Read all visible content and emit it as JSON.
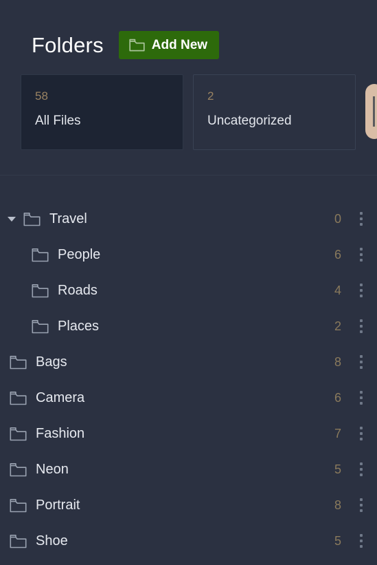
{
  "header": {
    "title": "Folders",
    "add_button": {
      "label": "Add New",
      "icon": "folder-icon",
      "color": "#2d6a0b"
    }
  },
  "stats": {
    "cards": [
      {
        "count": "58",
        "label": "All Files",
        "selected": true
      },
      {
        "count": "2",
        "label": "Uncategorized",
        "selected": false
      }
    ],
    "peek_card": {
      "color": "#d9bda6"
    }
  },
  "colors": {
    "background": "#2b3141",
    "card_selected_bg": "#1d2433",
    "card_border": "#394254",
    "accent_green": "#2d6a0b",
    "count_text": "#8a7a5c",
    "label_text": "#e6e9ef",
    "icon_stroke": "#9aa2b1",
    "divider": "#333b4b"
  },
  "tree": {
    "rows": [
      {
        "label": "Travel",
        "count": "0",
        "depth": 0,
        "caret": "chevron-down",
        "expanded": true
      },
      {
        "label": "People",
        "count": "6",
        "depth": 1,
        "caret": null
      },
      {
        "label": "Roads",
        "count": "4",
        "depth": 1,
        "caret": null
      },
      {
        "label": "Places",
        "count": "2",
        "depth": 1,
        "caret": null
      },
      {
        "label": "Bags",
        "count": "8",
        "depth": 0,
        "caret": null
      },
      {
        "label": "Camera",
        "count": "6",
        "depth": 0,
        "caret": null
      },
      {
        "label": "Fashion",
        "count": "7",
        "depth": 0,
        "caret": null
      },
      {
        "label": "Neon",
        "count": "5",
        "depth": 0,
        "caret": null
      },
      {
        "label": "Portrait",
        "count": "8",
        "depth": 0,
        "caret": null
      },
      {
        "label": "Shoe",
        "count": "5",
        "depth": 0,
        "caret": null
      }
    ],
    "row_menu_icon": "kebab-menu-icon"
  }
}
